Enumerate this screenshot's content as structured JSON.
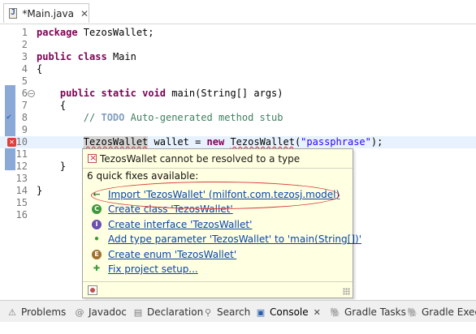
{
  "editor_tab": {
    "title": "*Main.java",
    "close": "✕"
  },
  "code_lines": [
    {
      "num": "1",
      "parts": [
        {
          "t": "package",
          "c": "kw"
        },
        {
          "t": " TezosWallet;"
        }
      ]
    },
    {
      "num": "2",
      "parts": []
    },
    {
      "num": "3",
      "parts": [
        {
          "t": "public",
          "c": "kw"
        },
        {
          "t": " "
        },
        {
          "t": "class",
          "c": "kw"
        },
        {
          "t": " Main"
        }
      ]
    },
    {
      "num": "4",
      "parts": [
        {
          "t": "{"
        }
      ]
    },
    {
      "num": "5",
      "parts": []
    },
    {
      "num": "6",
      "parts": [
        {
          "t": "    "
        },
        {
          "t": "public",
          "c": "kw"
        },
        {
          "t": " "
        },
        {
          "t": "static",
          "c": "kw"
        },
        {
          "t": " "
        },
        {
          "t": "void",
          "c": "kw"
        },
        {
          "t": " main(String[] args)"
        }
      ]
    },
    {
      "num": "7",
      "parts": [
        {
          "t": "    {"
        }
      ]
    },
    {
      "num": "8",
      "parts": [
        {
          "t": "        "
        },
        {
          "t": "// ",
          "c": "cm"
        },
        {
          "t": "TODO",
          "c": "todo"
        },
        {
          "t": " Auto-generated method stub",
          "c": "cm"
        }
      ]
    },
    {
      "num": "9",
      "parts": []
    },
    {
      "num": "10",
      "parts": [
        {
          "t": "        "
        },
        {
          "t": "TezosWallet",
          "c": "err occ"
        },
        {
          "t": " wallet = "
        },
        {
          "t": "new",
          "c": "kw"
        },
        {
          "t": " "
        },
        {
          "t": "TezosWallet",
          "c": "err"
        },
        {
          "t": "("
        },
        {
          "t": "\"passphrase\"",
          "c": "str"
        },
        {
          "t": ");"
        }
      ]
    },
    {
      "num": "11",
      "parts": []
    },
    {
      "num": "12",
      "parts": [
        {
          "t": "    }"
        }
      ]
    },
    {
      "num": "13",
      "parts": []
    },
    {
      "num": "14",
      "parts": [
        {
          "t": "}"
        }
      ]
    },
    {
      "num": "15",
      "parts": []
    },
    {
      "num": "16",
      "parts": []
    }
  ],
  "quickfix": {
    "error_message": "TezosWallet cannot be resolved to a type",
    "count_text": "6 quick fixes available:",
    "fixes": [
      {
        "label": "Import 'TezosWallet' (milfont.com.tezosj.model)",
        "icon": "import-arrow-icon",
        "color": "#3b7a3b",
        "glyph": "←"
      },
      {
        "label": "Create class 'TezosWallet'",
        "icon": "class-icon",
        "color": "#3a9a3a",
        "glyph": "C"
      },
      {
        "label": "Create interface 'TezosWallet'",
        "icon": "interface-icon",
        "color": "#6a4fb0",
        "glyph": "I"
      },
      {
        "label": "Add type parameter 'TezosWallet' to 'main(String[])'",
        "icon": "type-parameter-icon",
        "color": "#3a9a3a",
        "glyph": "•"
      },
      {
        "label": "Create enum 'TezosWallet'",
        "icon": "enum-icon",
        "color": "#a07030",
        "glyph": "E"
      },
      {
        "label": "Fix project setup...",
        "icon": "project-setup-icon",
        "color": "#3a9a3a",
        "glyph": "✚"
      }
    ]
  },
  "bottom_tabs": [
    {
      "label": "Problems",
      "icon": "problems-icon",
      "glyph": "⚠"
    },
    {
      "label": "Javadoc",
      "icon": "javadoc-icon",
      "glyph": "@"
    },
    {
      "label": "Declaration",
      "icon": "declaration-icon",
      "glyph": "▤"
    },
    {
      "label": "Search",
      "icon": "search-icon",
      "glyph": "⚲"
    },
    {
      "label": "Console",
      "icon": "console-icon",
      "glyph": "▣",
      "active": true,
      "close": "✕"
    },
    {
      "label": "Gradle Tasks",
      "icon": "gradle-tasks-icon",
      "glyph": "🐘"
    },
    {
      "label": "Gradle Execu",
      "icon": "gradle-executions-icon",
      "glyph": "🐘"
    }
  ],
  "colors": {
    "popup_bg": "#ffffe1",
    "link": "#0645ad",
    "keyword": "#7f0055",
    "comment": "#3f7f5f",
    "string": "#2a00ff",
    "error": "#e02020",
    "highlight_ellipse": "#d63a3a"
  }
}
